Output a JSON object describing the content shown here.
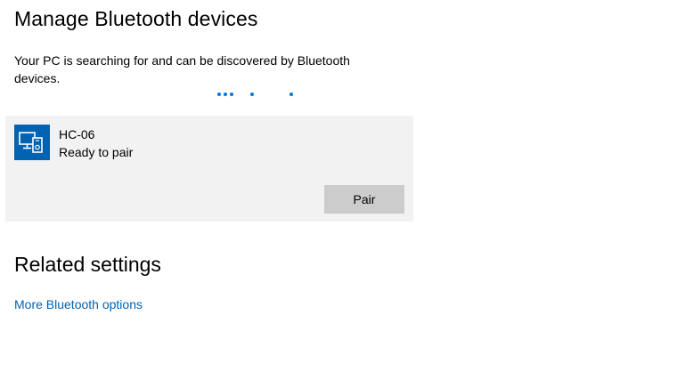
{
  "header": {
    "title": "Manage Bluetooth devices"
  },
  "search": {
    "description": "Your PC is searching for and can be discovered by Bluetooth devices."
  },
  "devices": [
    {
      "name": "HC-06",
      "status": "Ready to pair",
      "icon": "devices-icon",
      "action_label": "Pair"
    }
  ],
  "related": {
    "title": "Related settings",
    "link_label": "More Bluetooth options"
  },
  "colors": {
    "accent": "#0078d7",
    "icon_background": "#0063b1",
    "card_background": "#f2f2f2",
    "button_background": "#cccccc"
  }
}
